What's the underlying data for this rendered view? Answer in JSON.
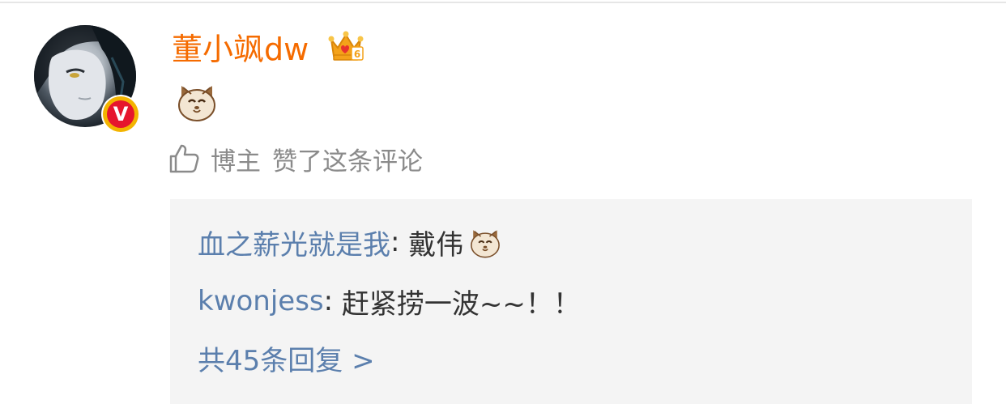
{
  "comment": {
    "username": "董小飒dw",
    "badge_letter": "V",
    "member_level": "6",
    "content_emoji": "cat-face-emoji",
    "liked_by_author_prefix": "博主",
    "liked_by_author_text": "赞了这条评论"
  },
  "replies": [
    {
      "user": "血之薪光就是我",
      "separator": ": ",
      "text": "戴伟",
      "emoji": "cat-face-emoji"
    },
    {
      "user": "kwonjess",
      "separator": ": ",
      "text": "赶紧捞一波~~！！"
    }
  ],
  "more_replies_label": "共45条回复 >",
  "colors": {
    "username": "#f56b00",
    "reply_user": "#5b7fad",
    "muted": "#8a8a8a",
    "reply_bg": "#f4f4f4",
    "verified_badge": "#e6162d"
  }
}
